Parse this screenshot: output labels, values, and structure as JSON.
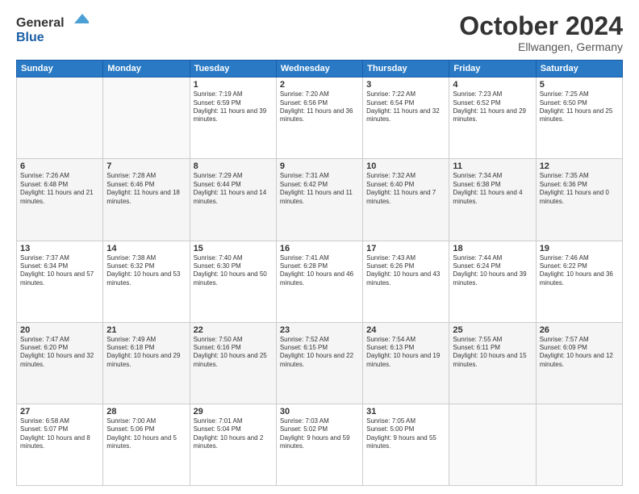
{
  "header": {
    "logo_general": "General",
    "logo_blue": "Blue",
    "month_title": "October 2024",
    "location": "Ellwangen, Germany"
  },
  "days_of_week": [
    "Sunday",
    "Monday",
    "Tuesday",
    "Wednesday",
    "Thursday",
    "Friday",
    "Saturday"
  ],
  "weeks": [
    {
      "days": [
        {
          "num": "",
          "content": ""
        },
        {
          "num": "",
          "content": ""
        },
        {
          "num": "1",
          "content": "Sunrise: 7:19 AM\nSunset: 6:59 PM\nDaylight: 11 hours and 39 minutes."
        },
        {
          "num": "2",
          "content": "Sunrise: 7:20 AM\nSunset: 6:56 PM\nDaylight: 11 hours and 36 minutes."
        },
        {
          "num": "3",
          "content": "Sunrise: 7:22 AM\nSunset: 6:54 PM\nDaylight: 11 hours and 32 minutes."
        },
        {
          "num": "4",
          "content": "Sunrise: 7:23 AM\nSunset: 6:52 PM\nDaylight: 11 hours and 29 minutes."
        },
        {
          "num": "5",
          "content": "Sunrise: 7:25 AM\nSunset: 6:50 PM\nDaylight: 11 hours and 25 minutes."
        }
      ]
    },
    {
      "days": [
        {
          "num": "6",
          "content": "Sunrise: 7:26 AM\nSunset: 6:48 PM\nDaylight: 11 hours and 21 minutes."
        },
        {
          "num": "7",
          "content": "Sunrise: 7:28 AM\nSunset: 6:46 PM\nDaylight: 11 hours and 18 minutes."
        },
        {
          "num": "8",
          "content": "Sunrise: 7:29 AM\nSunset: 6:44 PM\nDaylight: 11 hours and 14 minutes."
        },
        {
          "num": "9",
          "content": "Sunrise: 7:31 AM\nSunset: 6:42 PM\nDaylight: 11 hours and 11 minutes."
        },
        {
          "num": "10",
          "content": "Sunrise: 7:32 AM\nSunset: 6:40 PM\nDaylight: 11 hours and 7 minutes."
        },
        {
          "num": "11",
          "content": "Sunrise: 7:34 AM\nSunset: 6:38 PM\nDaylight: 11 hours and 4 minutes."
        },
        {
          "num": "12",
          "content": "Sunrise: 7:35 AM\nSunset: 6:36 PM\nDaylight: 11 hours and 0 minutes."
        }
      ]
    },
    {
      "days": [
        {
          "num": "13",
          "content": "Sunrise: 7:37 AM\nSunset: 6:34 PM\nDaylight: 10 hours and 57 minutes."
        },
        {
          "num": "14",
          "content": "Sunrise: 7:38 AM\nSunset: 6:32 PM\nDaylight: 10 hours and 53 minutes."
        },
        {
          "num": "15",
          "content": "Sunrise: 7:40 AM\nSunset: 6:30 PM\nDaylight: 10 hours and 50 minutes."
        },
        {
          "num": "16",
          "content": "Sunrise: 7:41 AM\nSunset: 6:28 PM\nDaylight: 10 hours and 46 minutes."
        },
        {
          "num": "17",
          "content": "Sunrise: 7:43 AM\nSunset: 6:26 PM\nDaylight: 10 hours and 43 minutes."
        },
        {
          "num": "18",
          "content": "Sunrise: 7:44 AM\nSunset: 6:24 PM\nDaylight: 10 hours and 39 minutes."
        },
        {
          "num": "19",
          "content": "Sunrise: 7:46 AM\nSunset: 6:22 PM\nDaylight: 10 hours and 36 minutes."
        }
      ]
    },
    {
      "days": [
        {
          "num": "20",
          "content": "Sunrise: 7:47 AM\nSunset: 6:20 PM\nDaylight: 10 hours and 32 minutes."
        },
        {
          "num": "21",
          "content": "Sunrise: 7:49 AM\nSunset: 6:18 PM\nDaylight: 10 hours and 29 minutes."
        },
        {
          "num": "22",
          "content": "Sunrise: 7:50 AM\nSunset: 6:16 PM\nDaylight: 10 hours and 25 minutes."
        },
        {
          "num": "23",
          "content": "Sunrise: 7:52 AM\nSunset: 6:15 PM\nDaylight: 10 hours and 22 minutes."
        },
        {
          "num": "24",
          "content": "Sunrise: 7:54 AM\nSunset: 6:13 PM\nDaylight: 10 hours and 19 minutes."
        },
        {
          "num": "25",
          "content": "Sunrise: 7:55 AM\nSunset: 6:11 PM\nDaylight: 10 hours and 15 minutes."
        },
        {
          "num": "26",
          "content": "Sunrise: 7:57 AM\nSunset: 6:09 PM\nDaylight: 10 hours and 12 minutes."
        }
      ]
    },
    {
      "days": [
        {
          "num": "27",
          "content": "Sunrise: 6:58 AM\nSunset: 5:07 PM\nDaylight: 10 hours and 8 minutes."
        },
        {
          "num": "28",
          "content": "Sunrise: 7:00 AM\nSunset: 5:06 PM\nDaylight: 10 hours and 5 minutes."
        },
        {
          "num": "29",
          "content": "Sunrise: 7:01 AM\nSunset: 5:04 PM\nDaylight: 10 hours and 2 minutes."
        },
        {
          "num": "30",
          "content": "Sunrise: 7:03 AM\nSunset: 5:02 PM\nDaylight: 9 hours and 59 minutes."
        },
        {
          "num": "31",
          "content": "Sunrise: 7:05 AM\nSunset: 5:00 PM\nDaylight: 9 hours and 55 minutes."
        },
        {
          "num": "",
          "content": ""
        },
        {
          "num": "",
          "content": ""
        }
      ]
    }
  ]
}
